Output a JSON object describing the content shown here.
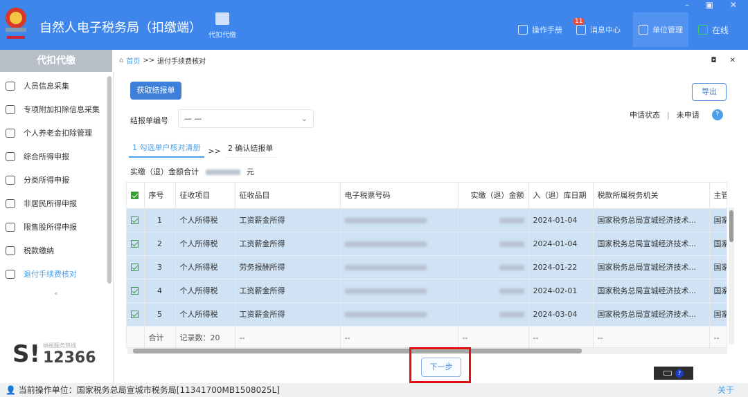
{
  "header": {
    "title": "自然人电子税务局（扣缴端）",
    "module": "代扣代缴",
    "nav": [
      {
        "label": "操作手册"
      },
      {
        "label": "消息中心",
        "badge": "11"
      },
      {
        "label": "单位管理"
      },
      {
        "label": "在线"
      }
    ],
    "window_controls": "– ▣ ✕"
  },
  "sidebar": {
    "title": "代扣代缴",
    "items": [
      {
        "label": "人员信息采集",
        "icon": "person-icon"
      },
      {
        "label": "专项附加扣除信息采集",
        "icon": "list-icon"
      },
      {
        "label": "个人养老金扣除管理",
        "icon": "pension-icon"
      },
      {
        "label": "综合所得申报",
        "icon": "layers-icon"
      },
      {
        "label": "分类所得申报",
        "icon": "pie-icon"
      },
      {
        "label": "非居民所得申报",
        "icon": "user-icon"
      },
      {
        "label": "限售股所得申报",
        "icon": "chart-icon"
      },
      {
        "label": "税款缴纳",
        "icon": "folder-icon"
      },
      {
        "label": "退付手续费核对",
        "icon": "check-doc-icon",
        "active": true
      }
    ],
    "collapse": "«",
    "hotline_label": "纳税服务热线",
    "hotline_number": "12366"
  },
  "breadcrumb": {
    "home": "首页",
    "sep": ">>",
    "current": "退付手续费核对"
  },
  "panel_controls": "◘ ✕",
  "toolbar": {
    "fetch": "获取结报单",
    "export": "导出"
  },
  "form": {
    "report_no_label": "结报单编号",
    "report_no_value": "— —",
    "status_label": "申请状态",
    "status_sep": "|",
    "status_value": "未申请",
    "help": "?"
  },
  "steps": {
    "step1": "1 勾选单户核对清册",
    "sep": ">>",
    "step2": "2 确认结报单"
  },
  "total": {
    "label": "实缴（退）金额合计",
    "unit": "元"
  },
  "table": {
    "columns": [
      "序号",
      "征收项目",
      "征收品目",
      "电子税票号码",
      "实缴（退）金额",
      "入（退）库日期",
      "税款所属税务机关",
      "主管"
    ],
    "rows": [
      {
        "no": "1",
        "item": "个人所得税",
        "sub": "工资薪金所得",
        "date": "2024-01-04",
        "office": "国家税务总局宣城经济技术...",
        "chief": "国家"
      },
      {
        "no": "2",
        "item": "个人所得税",
        "sub": "工资薪金所得",
        "date": "2024-01-04",
        "office": "国家税务总局宣城经济技术...",
        "chief": "国家"
      },
      {
        "no": "3",
        "item": "个人所得税",
        "sub": "劳务报酬所得",
        "date": "2024-01-22",
        "office": "国家税务总局宣城经济技术...",
        "chief": "国家"
      },
      {
        "no": "4",
        "item": "个人所得税",
        "sub": "工资薪金所得",
        "date": "2024-02-01",
        "office": "国家税务总局宣城经济技术...",
        "chief": "国家"
      },
      {
        "no": "5",
        "item": "个人所得税",
        "sub": "工资薪金所得",
        "date": "2024-03-04",
        "office": "国家税务总局宣城经济技术...",
        "chief": "国家"
      }
    ],
    "footer": {
      "label": "合计",
      "count": "记录数：20",
      "dash": "--"
    }
  },
  "next_button": "下一步",
  "statusbar": {
    "unit": "当前操作单位：国家税务总局宣城市税务局[11341700MB1508025L]",
    "about": "关于"
  },
  "colors": {
    "brand": "#3f86ec",
    "row_selected": "#cfe3f5",
    "highlight": "#e31010"
  }
}
